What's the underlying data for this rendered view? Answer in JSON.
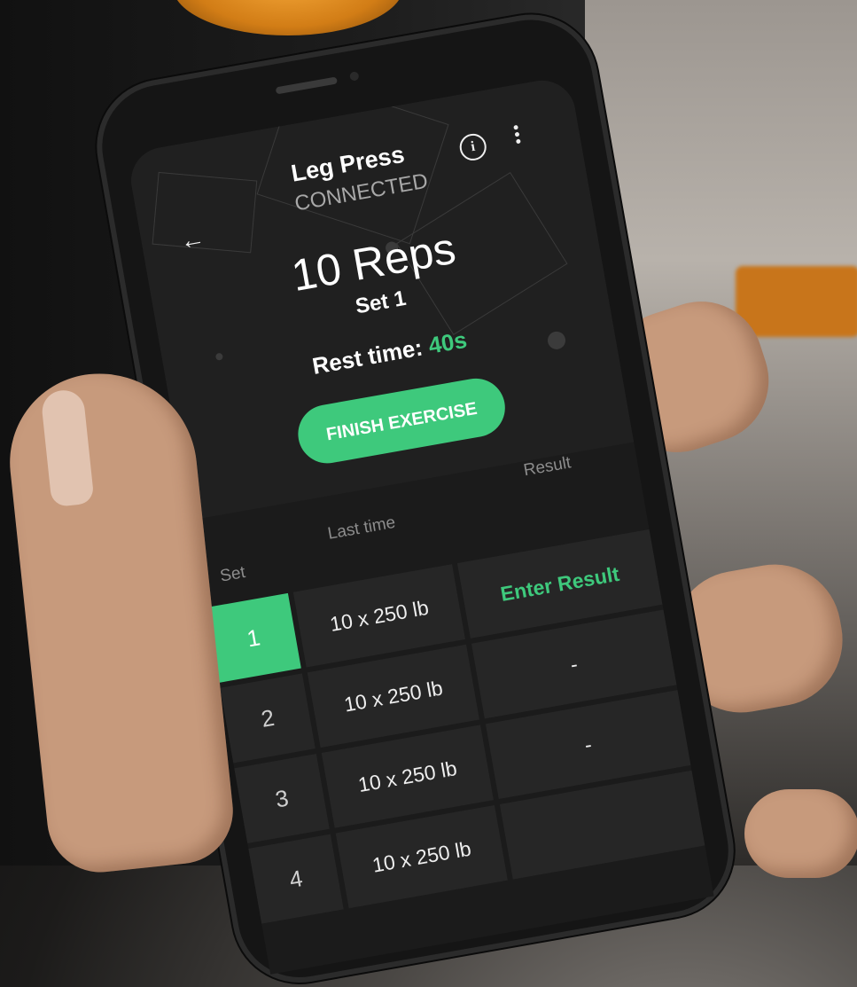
{
  "header": {
    "title": "Leg Press",
    "status": "CONNECTED",
    "back_icon": "arrow-left-icon",
    "info_icon": "info-icon",
    "more_icon": "more-vertical-icon"
  },
  "workout": {
    "reps": "10 Reps",
    "set": "Set 1",
    "rest_label": "Rest time:",
    "rest_value": "40s",
    "finish_label": "FINISH EXERCISE"
  },
  "table": {
    "headers": {
      "set": "Set",
      "last_time": "Last time",
      "result": "Result"
    },
    "rows": [
      {
        "set": "1",
        "last_time": "10 x 250 lb",
        "result": "Enter Result"
      },
      {
        "set": "2",
        "last_time": "10 x 250 lb",
        "result": "-"
      },
      {
        "set": "3",
        "last_time": "10 x 250 lb",
        "result": "-"
      },
      {
        "set": "4",
        "last_time": "10 x 250 lb",
        "result": ""
      }
    ]
  },
  "colors": {
    "accent": "#3ec97c",
    "background": "#1b1b1b",
    "row": "#262626"
  }
}
